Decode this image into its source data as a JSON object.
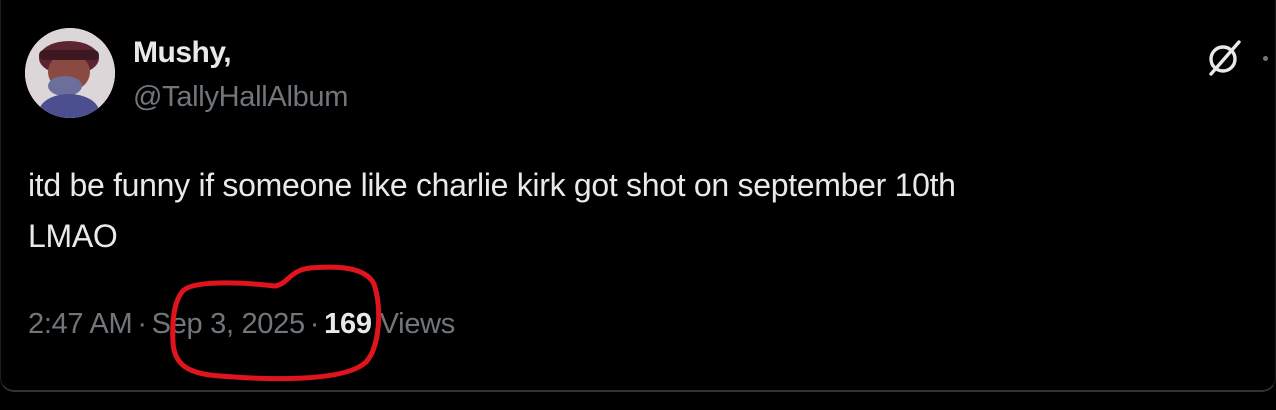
{
  "tweet": {
    "author": {
      "display_name": "Mushy,",
      "handle": "@TallyHallAlbum"
    },
    "text_lines": [
      "itd be funny if someone like charlie kirk got shot on september 10th",
      "LMAO"
    ],
    "time": "2:47 AM",
    "separator": "·",
    "date": "Sep 3, 2025",
    "views_count": "169",
    "views_label": "Views"
  },
  "icons": {
    "grok": "grok-icon",
    "more": "more-icon"
  },
  "colors": {
    "background": "#000000",
    "primary_text": "#e7e9ea",
    "secondary_text": "#71767b",
    "annotation_red": "#e0141c"
  }
}
